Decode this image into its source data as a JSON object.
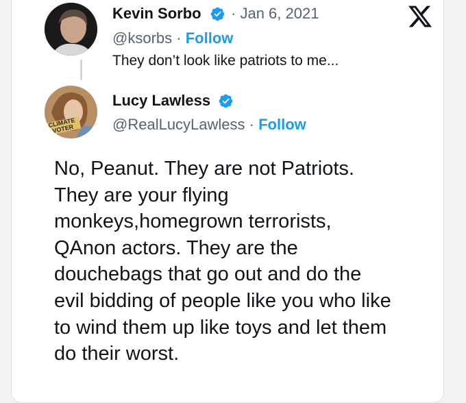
{
  "quoted": {
    "name": "Kevin Sorbo",
    "date": "Jan 6, 2021",
    "handle": "@ksorbs",
    "follow_label": "Follow",
    "text": "They don’t look like patriots to me..."
  },
  "reply": {
    "name": "Lucy Lawless",
    "handle": "@RealLucyLawless",
    "follow_label": "Follow",
    "badge": "CLIMATE VOTER",
    "text": "No, Peanut. They are not Patriots.\nThey are your flying\nmonkeys,homegrown terrorists,\nQAnon actors. They are the\ndouchebags that go out and do the\nevil bidding of people like you who like\nto wind them up like toys and let them\ndo their worst."
  },
  "separator": "·",
  "icons": {
    "verified": "verified-badge-icon",
    "platform": "x-logo-icon"
  },
  "colors": {
    "accent": "#1d9bf0",
    "secondary_text": "#536471",
    "primary_text": "#0f1419"
  }
}
